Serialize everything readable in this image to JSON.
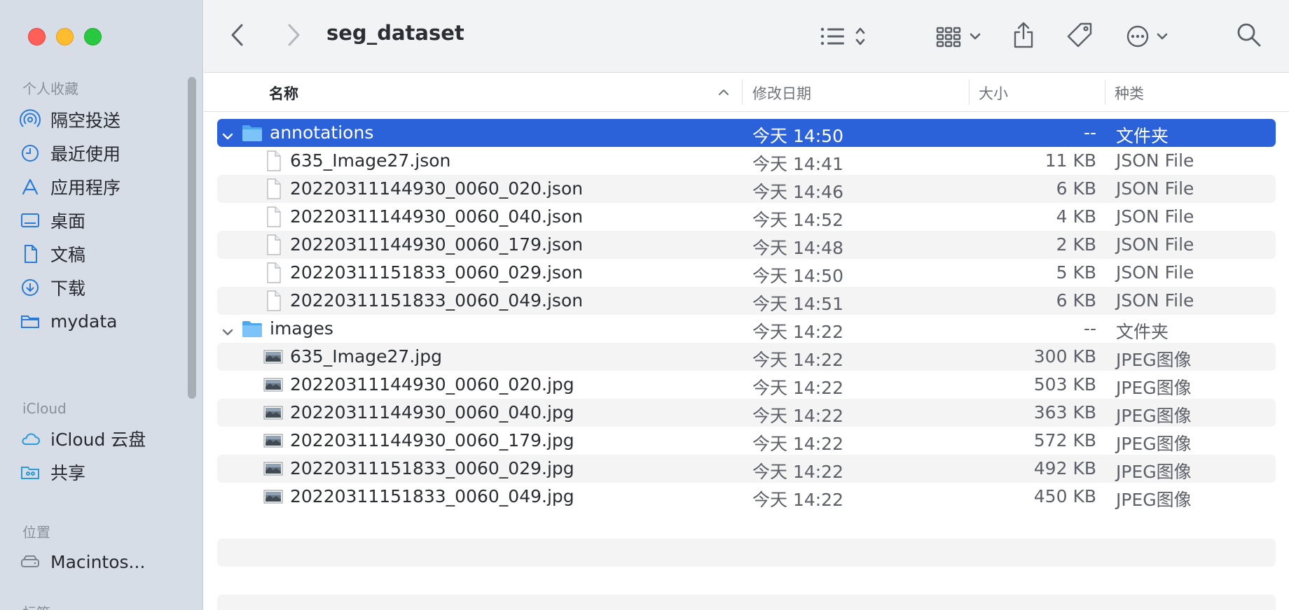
{
  "window": {
    "title": "seg_dataset"
  },
  "sidebar": {
    "sections": [
      {
        "title": "个人收藏"
      },
      {
        "title": "iCloud"
      },
      {
        "title": "位置"
      },
      {
        "title": "标签"
      }
    ],
    "favorites": [
      {
        "label": "隔空投送",
        "icon": "airdrop-icon"
      },
      {
        "label": "最近使用",
        "icon": "clock-icon"
      },
      {
        "label": "应用程序",
        "icon": "applications-icon"
      },
      {
        "label": "桌面",
        "icon": "desktop-icon"
      },
      {
        "label": "文稿",
        "icon": "document-icon"
      },
      {
        "label": "下载",
        "icon": "download-icon"
      },
      {
        "label": "mydata",
        "icon": "folder-icon"
      }
    ],
    "icloud": [
      {
        "label": "iCloud 云盘",
        "icon": "cloud-icon"
      },
      {
        "label": "共享",
        "icon": "shared-folder-icon"
      }
    ],
    "locations": [
      {
        "label": "Macintos...",
        "icon": "disk-icon"
      }
    ]
  },
  "columns": {
    "name": "名称",
    "date": "修改日期",
    "size": "大小",
    "kind": "种类"
  },
  "files": [
    {
      "name": "annotations",
      "date": "今天 14:50",
      "size": "--",
      "kind": "文件夹",
      "type": "folder",
      "level": 0,
      "selected": true
    },
    {
      "name": "635_Image27.json",
      "date": "今天 14:41",
      "size": "11 KB",
      "kind": "JSON File",
      "type": "json",
      "level": 1
    },
    {
      "name": "20220311144930_0060_020.json",
      "date": "今天 14:46",
      "size": "6 KB",
      "kind": "JSON File",
      "type": "json",
      "level": 1
    },
    {
      "name": "20220311144930_0060_040.json",
      "date": "今天 14:52",
      "size": "4 KB",
      "kind": "JSON File",
      "type": "json",
      "level": 1
    },
    {
      "name": "20220311144930_0060_179.json",
      "date": "今天 14:48",
      "size": "2 KB",
      "kind": "JSON File",
      "type": "json",
      "level": 1
    },
    {
      "name": "20220311151833_0060_029.json",
      "date": "今天 14:50",
      "size": "5 KB",
      "kind": "JSON File",
      "type": "json",
      "level": 1
    },
    {
      "name": "20220311151833_0060_049.json",
      "date": "今天 14:51",
      "size": "6 KB",
      "kind": "JSON File",
      "type": "json",
      "level": 1
    },
    {
      "name": "images",
      "date": "今天 14:22",
      "size": "--",
      "kind": "文件夹",
      "type": "folder",
      "level": 0
    },
    {
      "name": "635_Image27.jpg",
      "date": "今天 14:22",
      "size": "300 KB",
      "kind": "JPEG图像",
      "type": "image",
      "level": 1
    },
    {
      "name": "20220311144930_0060_020.jpg",
      "date": "今天 14:22",
      "size": "503 KB",
      "kind": "JPEG图像",
      "type": "image",
      "level": 1
    },
    {
      "name": "20220311144930_0060_040.jpg",
      "date": "今天 14:22",
      "size": "363 KB",
      "kind": "JPEG图像",
      "type": "image",
      "level": 1
    },
    {
      "name": "20220311144930_0060_179.jpg",
      "date": "今天 14:22",
      "size": "572 KB",
      "kind": "JPEG图像",
      "type": "image",
      "level": 1
    },
    {
      "name": "20220311151833_0060_029.jpg",
      "date": "今天 14:22",
      "size": "492 KB",
      "kind": "JPEG图像",
      "type": "image",
      "level": 1
    },
    {
      "name": "20220311151833_0060_049.jpg",
      "date": "今天 14:22",
      "size": "450 KB",
      "kind": "JPEG图像",
      "type": "image",
      "level": 1
    }
  ],
  "colors": {
    "selection": "#2c62d9",
    "sidebar_accent": "#2a7ad9",
    "folder": "#5fb4f0"
  },
  "toolbar": {
    "icons": [
      "back-icon",
      "forward-icon",
      "list-view-icon",
      "group-icon",
      "share-icon",
      "tag-icon",
      "more-icon",
      "search-icon"
    ]
  }
}
